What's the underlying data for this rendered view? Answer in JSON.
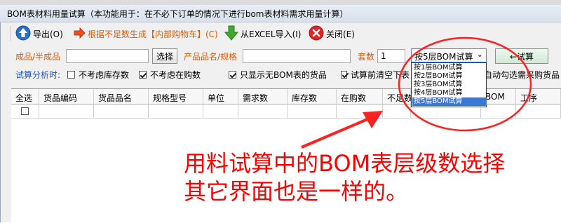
{
  "window": {
    "title": "BOM表材料用量试算（本功能用于：在不必下订单的情况下进行bom表材料需求用量计算）"
  },
  "toolbar": {
    "export": {
      "label": "导出(O)",
      "icon": "up-arrow-icon"
    },
    "generate": {
      "label": "根据不足数生成【内部购物车】(C)",
      "icon": "red-arrow-icon"
    },
    "import": {
      "label": "从EXCEL导入(I)",
      "icon": "green-down-arrow-icon"
    },
    "close": {
      "label": "关闭(E)",
      "icon": "close-icon"
    }
  },
  "filters": {
    "product_label": "成品/半成品",
    "product_value": "",
    "select_button": "选择",
    "name_label": "产品品名/规格",
    "name_value": "",
    "sets_label": "套数",
    "sets_value": "1",
    "bom_level_value": "按5层BOM试算",
    "trial_button": "←试算"
  },
  "options": {
    "section_label": "试算分析时:",
    "items": [
      {
        "label": "不考虑库存数",
        "checked": false
      },
      {
        "label": "不考虑在购数",
        "checked": true
      },
      {
        "label": "只显示无BOM表的货品",
        "checked": true
      },
      {
        "label": "试算前清空下表",
        "checked": true
      },
      {
        "label": "自动勾选需采购货品",
        "checked": false
      }
    ]
  },
  "bom_levels": [
    {
      "label": "按1层BOM试算",
      "selected": false
    },
    {
      "label": "按2层BOM试算",
      "selected": false
    },
    {
      "label": "按3层BOM试算",
      "selected": false
    },
    {
      "label": "按4层BOM试算",
      "selected": false
    },
    {
      "label": "按5层BOM试算",
      "selected": true
    }
  ],
  "table": {
    "columns": [
      "全选",
      "货品编码",
      "货品品名",
      "规格型号",
      "单位",
      "需求数",
      "库存数",
      "在购数",
      "不足数",
      "",
      "BOM",
      "工序"
    ]
  },
  "annotation": {
    "line1": "用料试算中的BOM表层级数选择",
    "line2": "其它界面也是一样的。",
    "color": "#ff0000"
  }
}
